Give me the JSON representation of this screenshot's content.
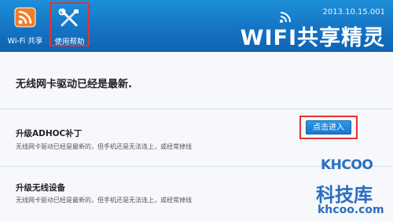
{
  "tabs": [
    {
      "label": "Wi-Fi 共享"
    },
    {
      "label": "使用帮助"
    }
  ],
  "brand": {
    "version": "2013.10.15.001",
    "name": "WIFI共享精灵"
  },
  "main": {
    "headline": "无线网卡驱动已经是最新.",
    "sections": [
      {
        "title": "升级ADHOC补丁",
        "desc": "无线网卡驱动已经是最新的，但手机还是无法连上，或经常掉线",
        "button": "点击进入"
      },
      {
        "title": "升级无线设备",
        "desc": "无线网卡驱动已经是最新的，但手机还是无法连上，或经常掉线"
      }
    ]
  },
  "watermark": {
    "logo": "KHCOO",
    "cn": "科技库",
    "url": "khcoo.com"
  },
  "colors": {
    "topbar": "#1574c4",
    "highlight": "#e53131",
    "button": "#1777cf"
  }
}
